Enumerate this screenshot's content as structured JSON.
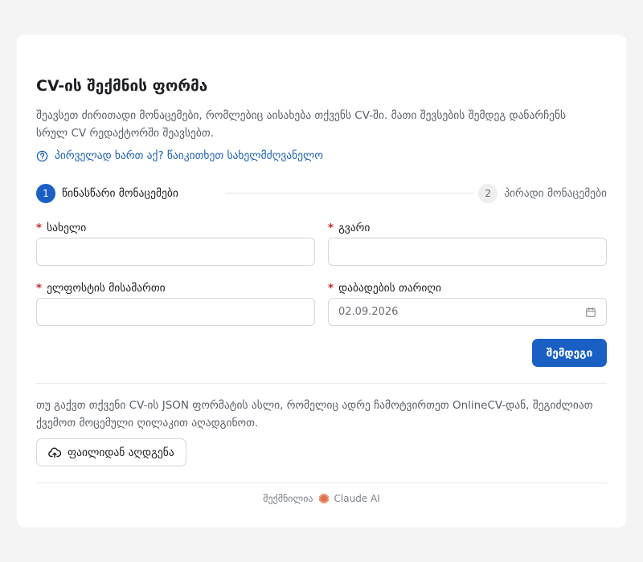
{
  "form": {
    "title": "CV-ის შექმნის ფორმა",
    "description": "შეავსეთ ძირითადი მონაცემები, რომლებიც აისახება თქვენს CV-ში. მათი შევსების შემდეგ დანარჩენს სრულ CV რედაქტორში შეავსებთ.",
    "help_link": "პირველად ხართ აქ? წაიკითხეთ სახელმძღვანელო"
  },
  "stepper": {
    "steps": [
      {
        "number": "1",
        "label": "წინასწარი მონაცემები",
        "active": true
      },
      {
        "number": "2",
        "label": "პირადი მონაცემები",
        "active": false
      }
    ]
  },
  "fields": {
    "first_name": {
      "label": "სახელი",
      "required": "*",
      "value": "",
      "placeholder": ""
    },
    "last_name": {
      "label": "გვარი",
      "required": "*",
      "value": "",
      "placeholder": ""
    },
    "email": {
      "label": "ელფოსტის მისამართი",
      "required": "*",
      "value": "",
      "placeholder": ""
    },
    "birth_date": {
      "label": "დაბადების თარიღი",
      "required": "*",
      "value": "02.09.2026"
    }
  },
  "buttons": {
    "next": "შემდეგი",
    "restore": "ფაილიდან აღდგენა"
  },
  "restore": {
    "text": "თუ გაქვთ თქვენი CV-ის JSON ფორმატის ასლი, რომელიც ადრე ჩამოტვირთეთ OnlineCV-დან, შეგიძლიათ ქვემოთ მოცემული ღილაკით აღადგინოთ."
  },
  "footer": {
    "prefix": "შექმნილია",
    "brand": "Claude AI",
    "icon": "claude-sparkle-icon"
  },
  "colors": {
    "primary": "#1a5fc4",
    "required": "#c62828",
    "link": "#1a5fb4",
    "brand_icon": "#e0734f"
  }
}
